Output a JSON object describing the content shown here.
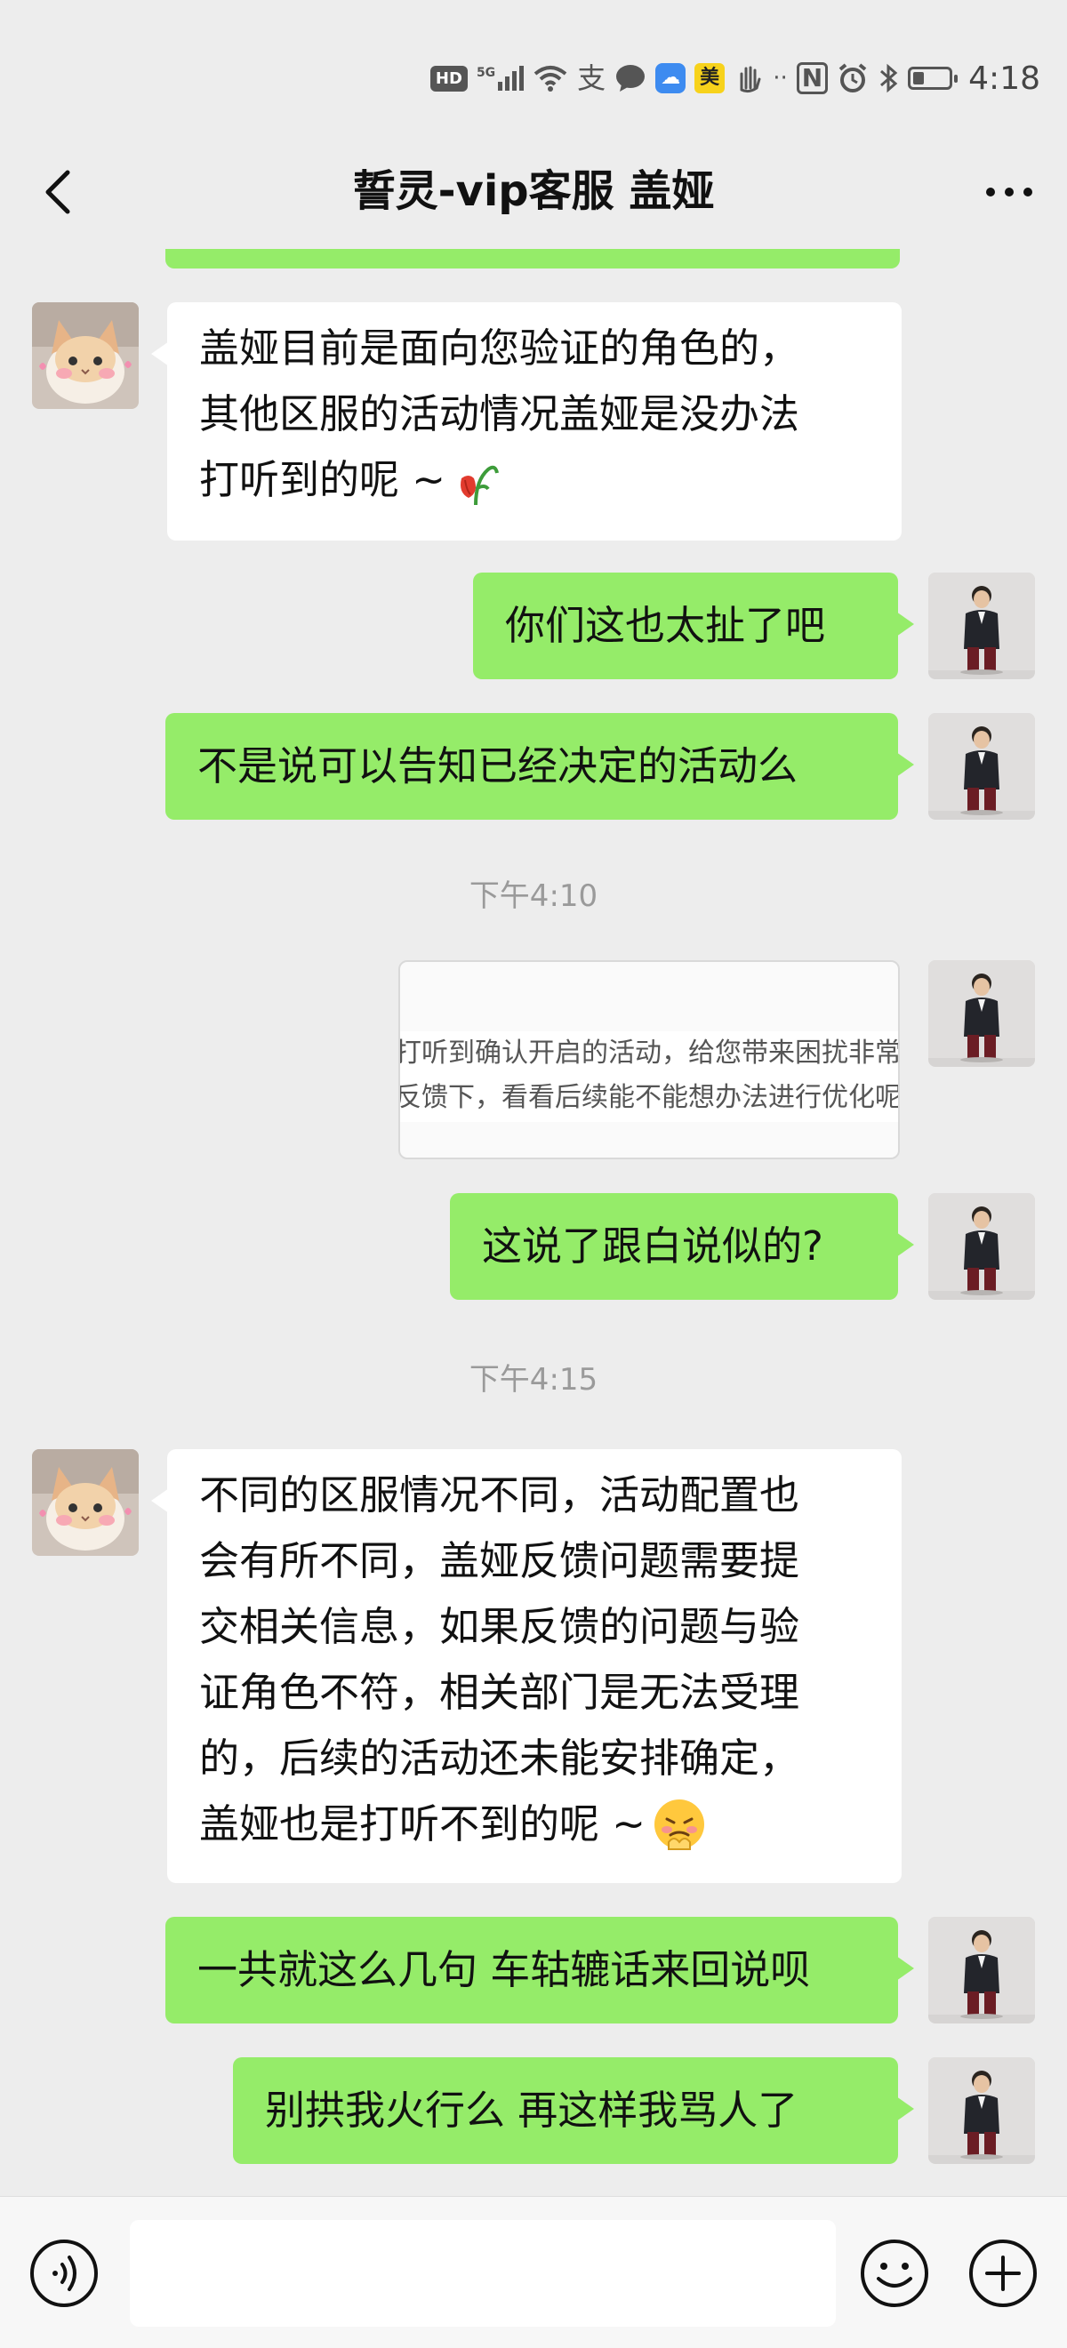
{
  "status_bar": {
    "network_badge": "HD",
    "signal_label": "5G",
    "app_badge": "美",
    "nfc_label": "N",
    "time": "4:18"
  },
  "header": {
    "back_icon": "chevron-left-icon",
    "title": "誓灵-vip客服 盖娅",
    "more_icon": "ellipsis-icon"
  },
  "messages": [
    {
      "direction": "in",
      "lines": [
        "盖娅目前是面向您验证的角色的，",
        "其他区服的活动情况盖娅是没办法",
        "打听到的呢 ~"
      ],
      "emoji": "wilted-flower"
    },
    {
      "direction": "out",
      "lines": [
        "你们这也太扯了吧"
      ]
    },
    {
      "direction": "out",
      "lines": [
        "不是说可以告知已经决定的活动么"
      ]
    },
    {
      "type": "timestamp",
      "text": "下午4:10"
    },
    {
      "direction": "out",
      "type": "image",
      "lines": [
        "打听到确认开启的活动，给您带来困扰非常抱",
        "反馈下，看看后续能不能想办法进行优化呢"
      ]
    },
    {
      "direction": "out",
      "lines": [
        "这说了跟白说似的?"
      ]
    },
    {
      "type": "timestamp",
      "text": "下午4:15"
    },
    {
      "direction": "in",
      "lines": [
        "不同的区服情况不同，活动配置也",
        "会有所不同，盖娅反馈问题需要提",
        "交相关信息，如果反馈的问题与验",
        "证角色不符，相关部门是无法受理",
        "的，后续的活动还未能安排确定，",
        "盖娅也是打听不到的呢 ~"
      ],
      "emoji": "persevering-face"
    },
    {
      "direction": "out",
      "lines": [
        "一共就这么几句 车轱辘话来回说呗"
      ]
    },
    {
      "direction": "out",
      "lines": [
        "别拱我火行么 再这样我骂人了"
      ]
    }
  ],
  "input_bar": {
    "voice_icon": "voice-icon",
    "text_value": "",
    "emoji_icon": "emoji-icon",
    "plus_icon": "plus-icon"
  },
  "colors": {
    "background": "#ededed",
    "outgoing_bubble": "#95ec69",
    "incoming_bubble": "#ffffff",
    "timestamp_text": "#9a9a9a"
  }
}
